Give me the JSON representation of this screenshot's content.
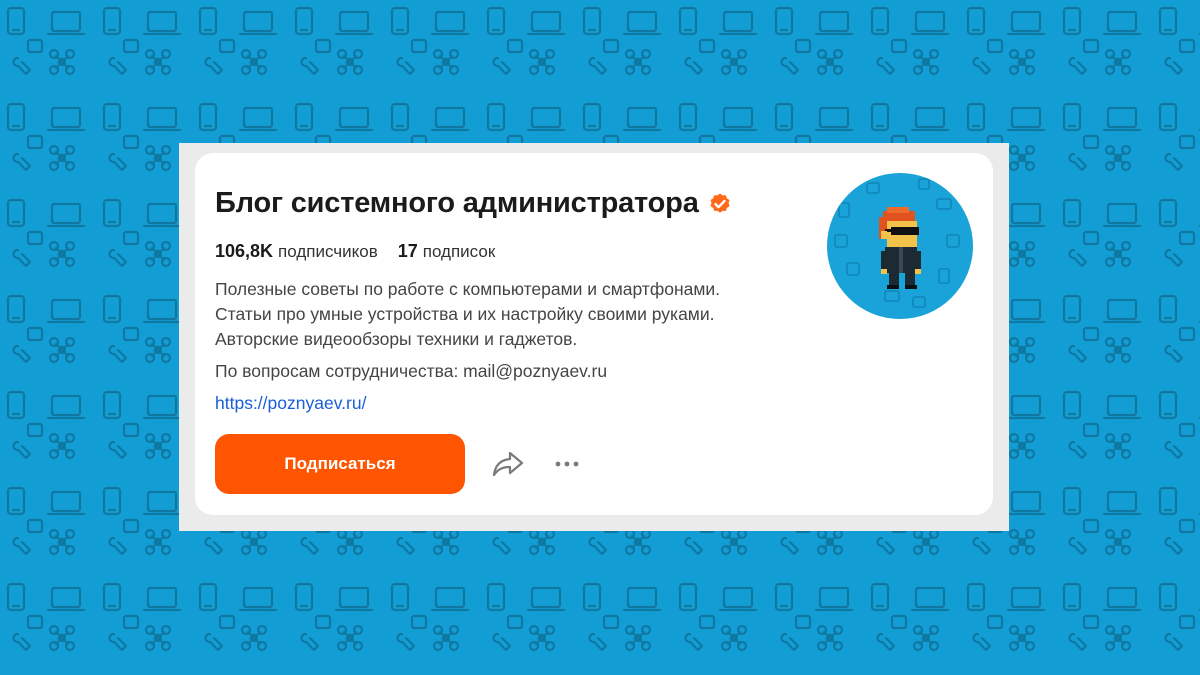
{
  "channel": {
    "title": "Блог системного администратора",
    "verified_icon": "verified-check-icon",
    "subscribers_count": "106,8K",
    "subscribers_label": "подписчиков",
    "subscriptions_count": "17",
    "subscriptions_label": "подписок",
    "description": [
      "Полезные советы по работе с компьютерами и смартфонами.",
      "Статьи про умные устройства и их настройку своими руками.",
      "Авторские видеообзоры техники и гаджетов."
    ],
    "contact": "По вопросам сотрудничества: mail@poznyaev.ru",
    "link": "https://poznyaev.ru/"
  },
  "actions": {
    "subscribe_label": "Подписаться",
    "share_icon": "share-arrow-icon",
    "more_icon": "more-dots-icon"
  },
  "colors": {
    "background": "#129ed4",
    "accent": "#ff5500",
    "link": "#1a5fd6",
    "verified": "#ff6a1a"
  }
}
